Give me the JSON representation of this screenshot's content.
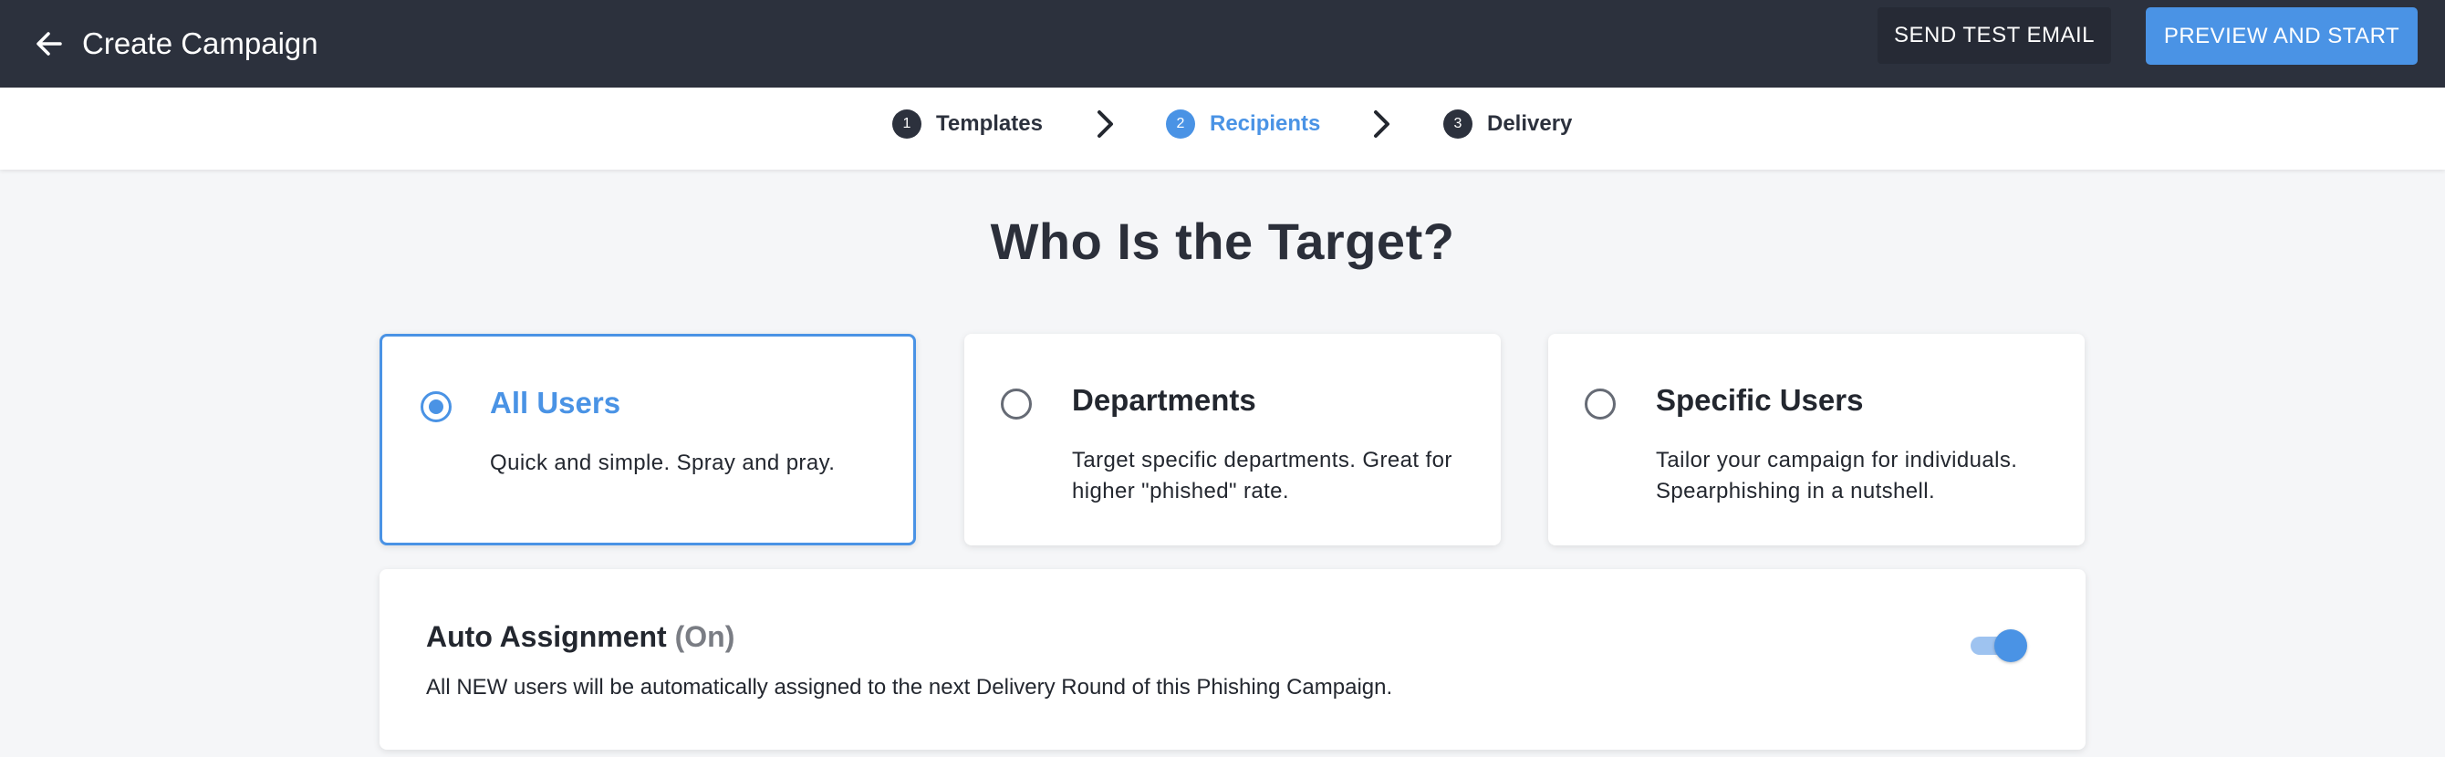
{
  "header": {
    "title": "Create Campaign",
    "send_test_label": "SEND TEST EMAIL",
    "preview_label": "PREVIEW AND START"
  },
  "stepper": {
    "steps": [
      {
        "number": "1",
        "label": "Templates",
        "active": false
      },
      {
        "number": "2",
        "label": "Recipients",
        "active": true
      },
      {
        "number": "3",
        "label": "Delivery",
        "active": false
      }
    ]
  },
  "main": {
    "heading": "Who Is the Target?",
    "options": [
      {
        "title": "All Users",
        "description": "Quick and simple. Spray and pray.",
        "selected": true
      },
      {
        "title": "Departments",
        "description": "Target specific departments. Great for higher \"phished\" rate.",
        "selected": false
      },
      {
        "title": "Specific Users",
        "description": "Tailor your campaign for individuals. Spearphishing in a nutshell.",
        "selected": false
      }
    ],
    "auto_assignment": {
      "title": "Auto Assignment",
      "status": "(On)",
      "description": "All NEW users will be automatically assigned to the next Delivery Round of this Phishing Campaign.",
      "enabled": true
    }
  },
  "colors": {
    "header_bg": "#2c313d",
    "accent": "#4a93e5",
    "page_bg": "#f5f6f8"
  },
  "icons": {
    "back": "arrow-left-icon",
    "step_separator": "chevron-right-icon"
  }
}
